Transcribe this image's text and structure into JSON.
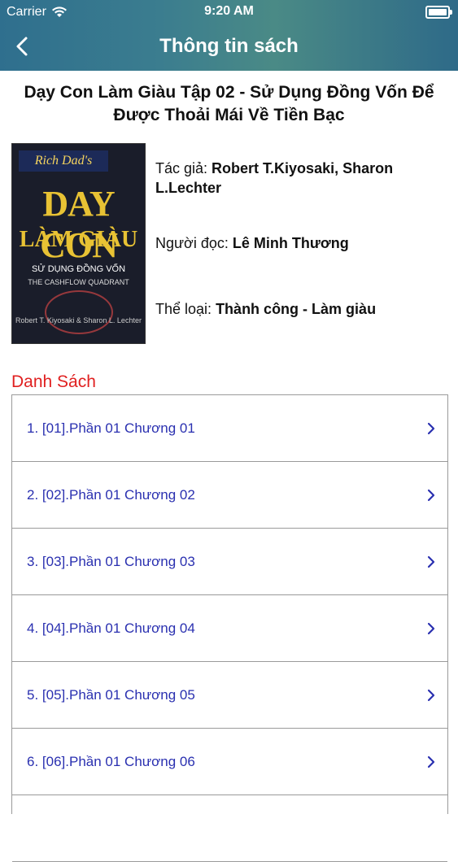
{
  "status": {
    "carrier": "Carrier",
    "time": "9:20 AM"
  },
  "nav": {
    "title": "Thông tin sách"
  },
  "book": {
    "title": "Dạy Con Làm Giàu Tập 02 - Sử Dụng Đồng Vốn Để Được Thoải Mái Về Tiền Bạc",
    "cover": {
      "brand": "Rich Dad's",
      "headline1": "DAY CON",
      "headline2": "LÀM GIÀU",
      "subtitle": "SỬ DỤNG ĐỒNG VỐN",
      "english": "THE CASHFLOW QUADRANT",
      "authors": "Robert T. Kiyosaki & Sharon L. Lechter"
    },
    "author_label": "Tác giả:",
    "author_value": "Robert T.Kiyosaki, Sharon L.Lechter",
    "reader_label": "Người đọc:",
    "reader_value": "Lê Minh Thương",
    "genre_label": "Thể loại:",
    "genre_value": "Thành công - Làm giàu"
  },
  "list": {
    "heading": "Danh Sách",
    "items": [
      "1. [01].Phần 01 Chương 01",
      "2. [02].Phần 01 Chương 02",
      "3. [03].Phần 01 Chương 03",
      "4. [04].Phần 01 Chương 04",
      "5. [05].Phần 01 Chương 05",
      "6. [06].Phần 01 Chương 06",
      ""
    ]
  }
}
